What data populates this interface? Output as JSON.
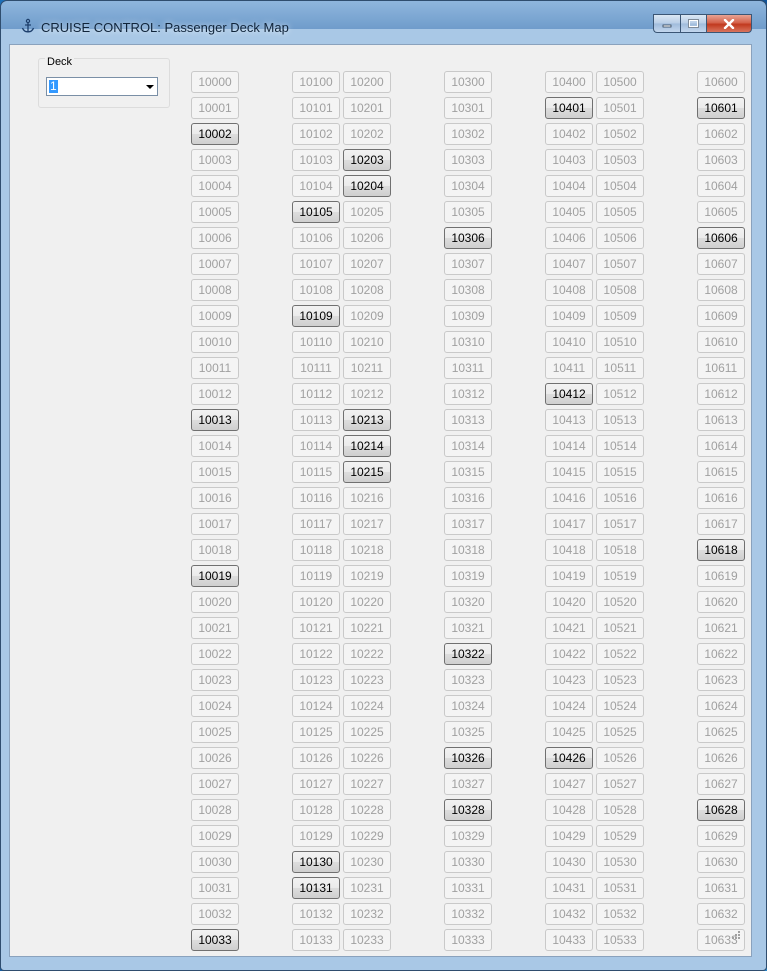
{
  "window": {
    "title": "CRUISE CONTROL: Passenger Deck Map",
    "app_icon": "anchor-icon",
    "minimize_icon": "minimize-icon",
    "maximize_icon": "maximize-icon",
    "close_icon": "close-icon"
  },
  "deck_selector": {
    "label": "Deck",
    "value": "1"
  },
  "colors": {
    "active_text": "#000000",
    "inactive_text": "#a0a0a0",
    "client_background": "#f0f0f0"
  },
  "cabins": {
    "columns": [
      {
        "start": 10000,
        "count": 34
      },
      {
        "start": 10100,
        "count": 34
      },
      {
        "start": 10200,
        "count": 34
      },
      {
        "start": 10300,
        "count": 34
      },
      {
        "start": 10400,
        "count": 34
      },
      {
        "start": 10500,
        "count": 34
      },
      {
        "start": 10600,
        "count": 34
      }
    ],
    "active": [
      "10002",
      "10013",
      "10019",
      "10033",
      "10105",
      "10109",
      "10130",
      "10131",
      "10203",
      "10204",
      "10213",
      "10214",
      "10215",
      "10306",
      "10322",
      "10326",
      "10328",
      "10401",
      "10412",
      "10426",
      "10601",
      "10606",
      "10618",
      "10628"
    ]
  }
}
